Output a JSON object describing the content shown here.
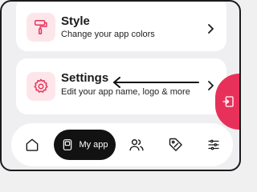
{
  "style_card": {
    "title": "Style",
    "subtitle": "Change your app colors",
    "icon": "paint-roller-icon"
  },
  "settings_card": {
    "title": "Settings",
    "subtitle": "Edit your app name, logo & more",
    "icon": "gear-icon"
  },
  "side_tab": {
    "icon": "exit-icon",
    "color": "#e8315a"
  },
  "nav": {
    "items": [
      {
        "name": "home",
        "icon": "home-icon"
      },
      {
        "name": "my-app",
        "label": "My app",
        "icon": "phone-icon",
        "active": true
      },
      {
        "name": "users",
        "icon": "users-icon"
      },
      {
        "name": "offers",
        "icon": "tag-icon"
      },
      {
        "name": "more",
        "icon": "menu-icon"
      }
    ]
  },
  "colors": {
    "accent": "#e8315a",
    "icon_bg": "#fde6ea",
    "nav_active": "#121212"
  }
}
